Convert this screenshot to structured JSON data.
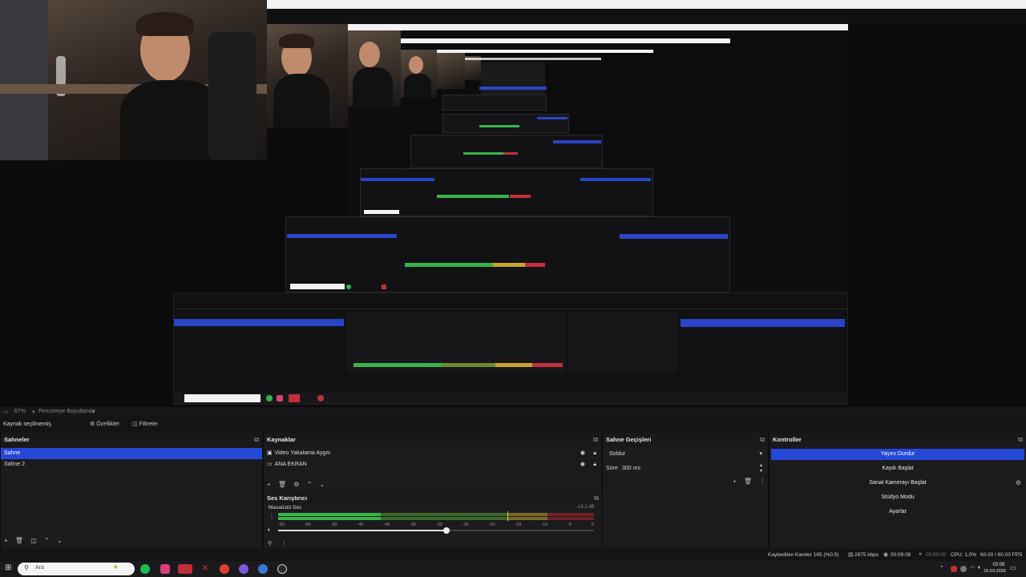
{
  "preview": {
    "toolbar_zoom": "67%",
    "toolbar_label": "Pencereye Boyutlandır"
  },
  "sources_toolbar": {
    "status": "Kaynak seçilmemiş",
    "properties_label": "Özellikler",
    "filters_label": "Filtreler"
  },
  "scenes": {
    "title": "Sahneler",
    "items": [
      {
        "label": "Sahne",
        "selected": true
      },
      {
        "label": "Sahne 2",
        "selected": false
      }
    ]
  },
  "sources": {
    "title": "Kaynaklar",
    "items": [
      {
        "label": "Video Yakalama Aygıtı",
        "icon": "camera-icon"
      },
      {
        "label": "ANA EKRAN",
        "icon": "monitor-icon"
      }
    ]
  },
  "mixer": {
    "title": "Ses Karıştırıcı",
    "channel_label": "Masaüstü Ses",
    "level": "-16.2 dB",
    "ticks": [
      "0",
      "-5",
      "-10",
      "-15",
      "-20",
      "-25",
      "-30",
      "-35",
      "-40",
      "-45",
      "-50",
      "-55",
      "-60"
    ]
  },
  "transitions": {
    "title": "Sahne Geçişleri",
    "type_value": "Soldur",
    "duration_label": "Süre",
    "duration_value": "300 ms"
  },
  "controls": {
    "title": "Kontroller",
    "buttons": [
      {
        "label": "Yayını Durdur",
        "primary": true
      },
      {
        "label": "Kaydı Başlat",
        "primary": false
      },
      {
        "label": "Sanal Kamerayı Başlat",
        "primary": false
      },
      {
        "label": "Stüdyo Modu",
        "primary": false
      },
      {
        "label": "Ayarlar",
        "primary": false
      }
    ]
  },
  "status": {
    "dropped_frames": "Kaybedilen Kareler 165 (%0.5)",
    "bitrate": "2875 kbps",
    "stream_time": "00:09:08",
    "rec_time": "00:00:00",
    "cpu": "CPU: 1.0%",
    "fps": "60.00 / 60.00 FPS"
  },
  "taskbar": {
    "search_placeholder": "Ara",
    "clock_time": "02:08",
    "clock_date": "15.03.2026"
  },
  "colors": {
    "accent": "#2447d6",
    "meter_green": "#36b44a",
    "meter_yellow": "#c9a62a",
    "meter_red": "#c0303a"
  }
}
